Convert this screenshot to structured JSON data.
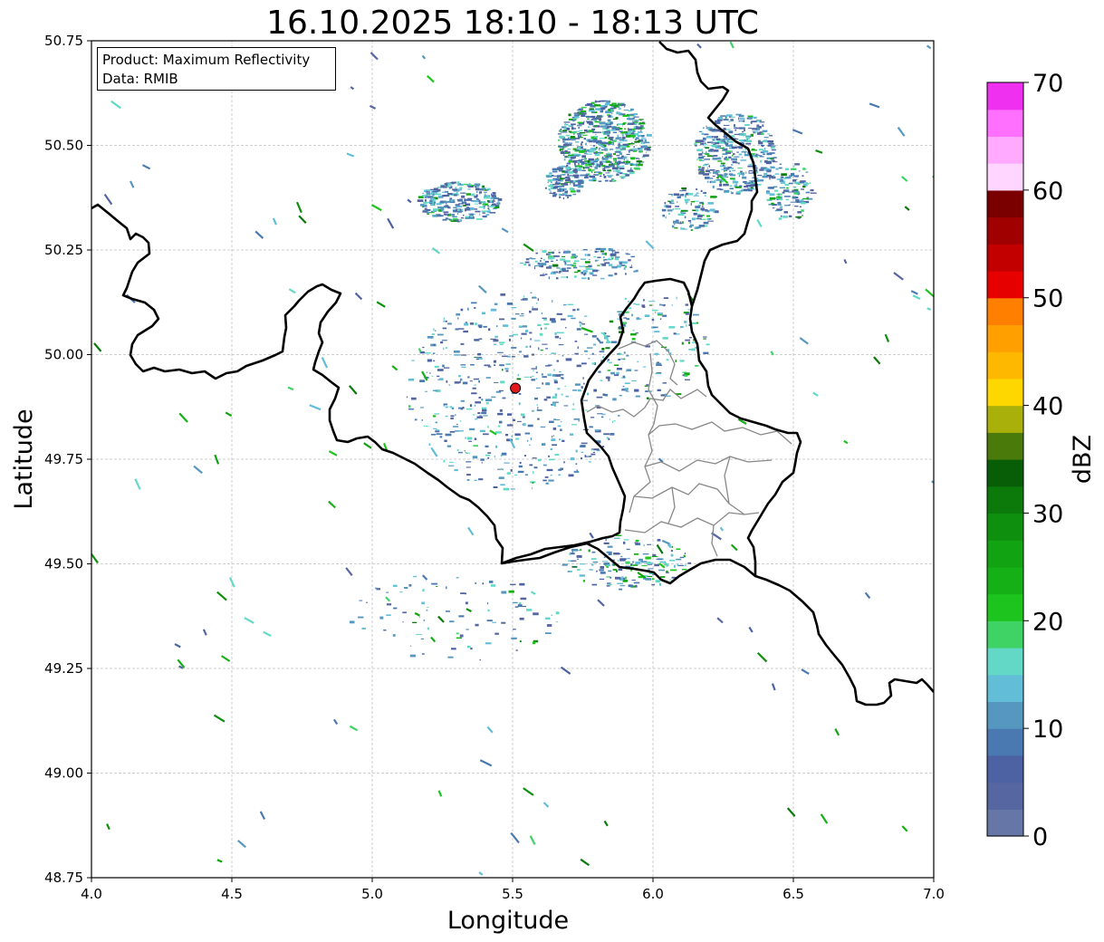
{
  "title": "16.10.2025 18:10 - 18:13 UTC",
  "annotation": {
    "product": "Product: Maximum Reflectivity",
    "data": "Data: RMIB"
  },
  "axes": {
    "xlabel": "Longitude",
    "ylabel": "Latitude",
    "xlim": [
      4.0,
      7.0
    ],
    "ylim": [
      48.75,
      50.75
    ],
    "xticks": [
      "4.0",
      "4.5",
      "5.0",
      "5.5",
      "6.0",
      "6.5",
      "7.0"
    ],
    "yticks": [
      "48.75",
      "49.00",
      "49.25",
      "49.50",
      "49.75",
      "50.00",
      "50.25",
      "50.50",
      "50.75"
    ],
    "grid": true
  },
  "radar_site": {
    "lon": 5.51,
    "lat": 49.92,
    "color": "#e31a1c"
  },
  "colorbar": {
    "label": "dBZ",
    "ticks": [
      "0",
      "10",
      "20",
      "30",
      "40",
      "50",
      "60",
      "70"
    ],
    "min": 0,
    "max": 70,
    "colors": [
      "#6676a6",
      "#5566a0",
      "#4c62a3",
      "#4a78b0",
      "#5597bf",
      "#62bdd7",
      "#63d8c6",
      "#3fd366",
      "#1ec41e",
      "#15b015",
      "#11a311",
      "#0e8f0e",
      "#0b7a0b",
      "#075e07",
      "#4a7a0a",
      "#aab00a",
      "#ffd700",
      "#ffb800",
      "#ff9f00",
      "#ff7f00",
      "#e60000",
      "#c20000",
      "#a00000",
      "#7a0000",
      "#ffd6ff",
      "#ffaaff",
      "#ff70ff",
      "#f030f0"
    ]
  },
  "legend_colors": {
    "border": "#000000",
    "provinces": "#888888",
    "grid": "#c0c0c0"
  }
}
